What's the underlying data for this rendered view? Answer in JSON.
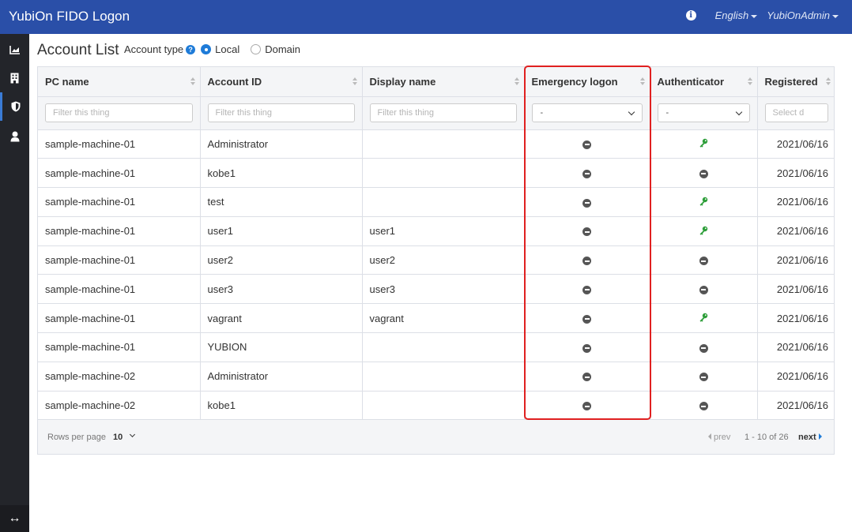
{
  "app": {
    "title": "YubiOn FIDO Logon"
  },
  "header": {
    "language": "English",
    "user": "YubiOnAdmin"
  },
  "sidebar": {
    "items": [
      "chart-icon",
      "building-icon",
      "shield-icon",
      "user-icon"
    ],
    "collapse": "↔"
  },
  "page": {
    "title": "Account List",
    "account_type_label": "Account type",
    "options": [
      "Local",
      "Domain"
    ],
    "selected": "Local"
  },
  "table": {
    "columns": [
      "PC name",
      "Account ID",
      "Display name",
      "Emergency logon",
      "Authenticator",
      "Registered"
    ],
    "filters": {
      "placeholder": "Filter this thing",
      "select_value": "-",
      "date_placeholder": "Select d"
    },
    "rows": [
      {
        "pc": "sample-machine-01",
        "account": "Administrator",
        "display": "",
        "emergency": "none",
        "auth": "key",
        "registered": "2021/06/16"
      },
      {
        "pc": "sample-machine-01",
        "account": "kobe1",
        "display": "",
        "emergency": "none",
        "auth": "none",
        "registered": "2021/06/16"
      },
      {
        "pc": "sample-machine-01",
        "account": "test",
        "display": "",
        "emergency": "none",
        "auth": "key",
        "registered": "2021/06/16"
      },
      {
        "pc": "sample-machine-01",
        "account": "user1",
        "display": "user1",
        "emergency": "none",
        "auth": "key",
        "registered": "2021/06/16"
      },
      {
        "pc": "sample-machine-01",
        "account": "user2",
        "display": "user2",
        "emergency": "none",
        "auth": "none",
        "registered": "2021/06/16"
      },
      {
        "pc": "sample-machine-01",
        "account": "user3",
        "display": "user3",
        "emergency": "none",
        "auth": "none",
        "registered": "2021/06/16"
      },
      {
        "pc": "sample-machine-01",
        "account": "vagrant",
        "display": "vagrant",
        "emergency": "none",
        "auth": "key",
        "registered": "2021/06/16"
      },
      {
        "pc": "sample-machine-01",
        "account": "YUBION",
        "display": "",
        "emergency": "none",
        "auth": "none",
        "registered": "2021/06/16"
      },
      {
        "pc": "sample-machine-02",
        "account": "Administrator",
        "display": "",
        "emergency": "none",
        "auth": "none",
        "registered": "2021/06/16"
      },
      {
        "pc": "sample-machine-02",
        "account": "kobe1",
        "display": "",
        "emergency": "none",
        "auth": "none",
        "registered": "2021/06/16"
      }
    ]
  },
  "footer": {
    "rows_per_page_label": "Rows per page",
    "rows_per_page": "10",
    "prev": "prev",
    "range": "1 - 10 of 26",
    "next": "next"
  },
  "colors": {
    "header_bg": "#2a4fa8",
    "sidebar_bg": "#23252a",
    "key_green": "#2e9e3a",
    "highlight": "#e02020",
    "accent": "#1e7bd8"
  }
}
